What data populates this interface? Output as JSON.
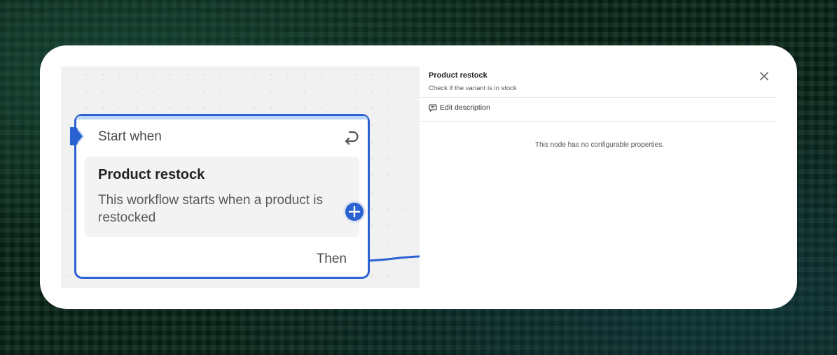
{
  "node": {
    "header": "Start when",
    "trigger_title": "Product restock",
    "trigger_description": "This workflow starts when a product is restocked",
    "then_label": "Then",
    "icons": {
      "notch": "input-notch-icon",
      "return": "return-arrow-icon",
      "add": "plus-icon"
    }
  },
  "panel": {
    "title": "Product restock",
    "subtitle": "Check if the variant is in stock",
    "edit_description_label": "Edit description",
    "empty_message": "This node has no configurable properties.",
    "icons": {
      "close": "close-icon",
      "comment": "comment-icon"
    }
  },
  "colors": {
    "accent": "#2b62d1",
    "node_top_bar": "#bcd6f5",
    "canvas_bg": "#f1f1f1"
  }
}
